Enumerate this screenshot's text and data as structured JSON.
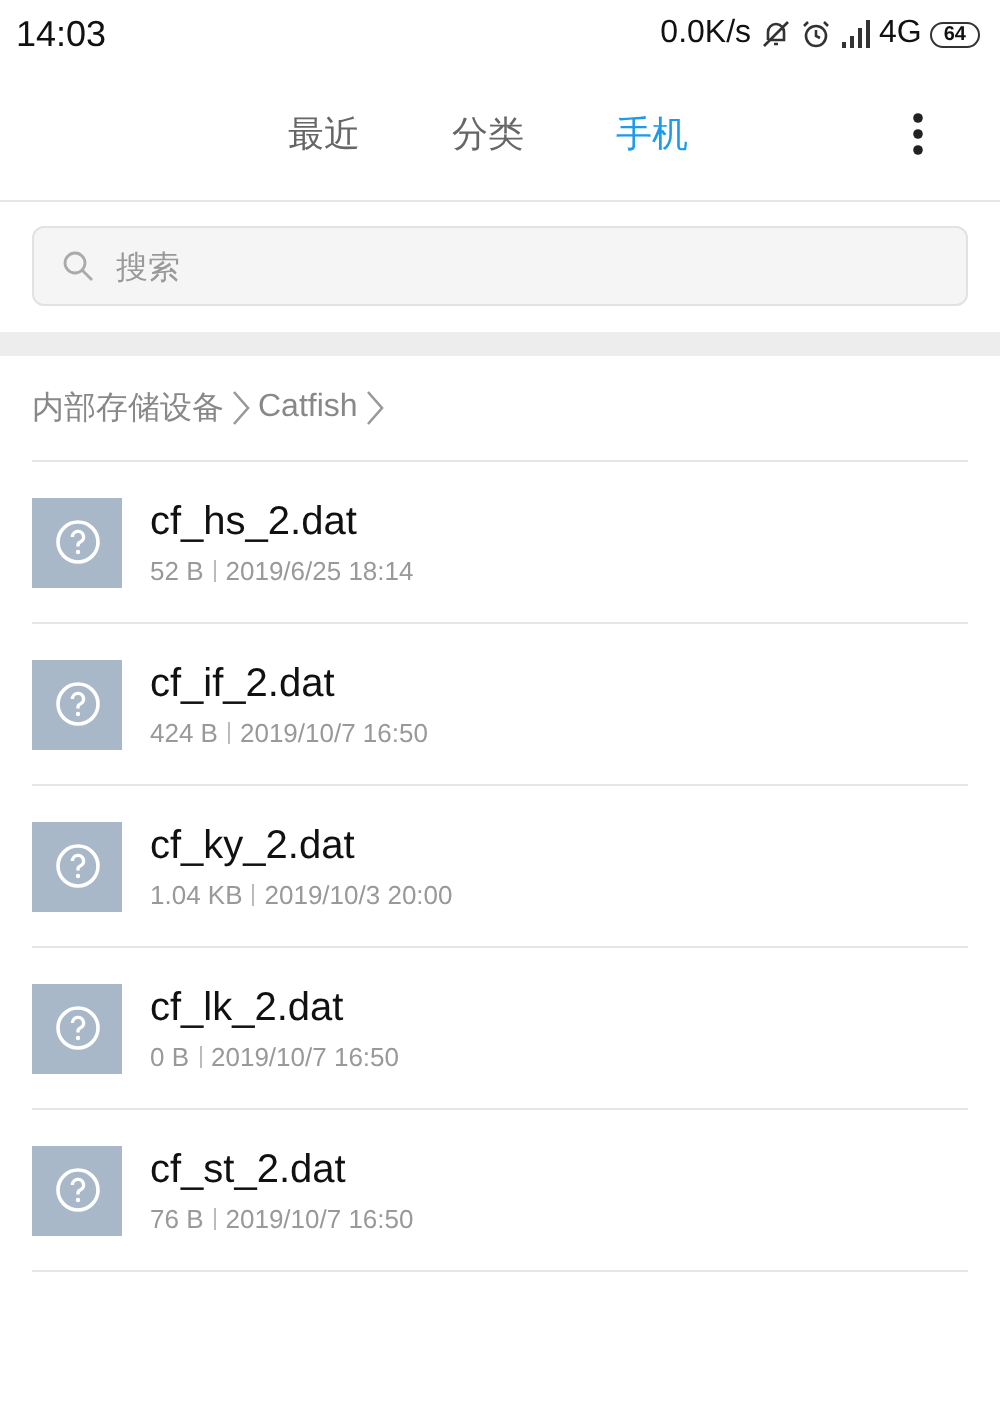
{
  "status_bar": {
    "time": "14:03",
    "speed": "0.0K/s",
    "network": "4G",
    "battery": "64"
  },
  "tabs": [
    {
      "label": "最近",
      "selected": false
    },
    {
      "label": "分类",
      "selected": false
    },
    {
      "label": "手机",
      "selected": true
    }
  ],
  "search": {
    "placeholder": "搜索"
  },
  "breadcrumb": [
    "内部存储设备",
    "Catfish"
  ],
  "files": [
    {
      "name": "cf_hs_2.dat",
      "size": "52 B",
      "date": "2019/6/25 18:14"
    },
    {
      "name": "cf_if_2.dat",
      "size": "424 B",
      "date": "2019/10/7 16:50"
    },
    {
      "name": "cf_ky_2.dat",
      "size": "1.04 KB",
      "date": "2019/10/3 20:00"
    },
    {
      "name": "cf_lk_2.dat",
      "size": "0 B",
      "date": "2019/10/7 16:50"
    },
    {
      "name": "cf_st_2.dat",
      "size": "76 B",
      "date": "2019/10/7 16:50"
    }
  ]
}
